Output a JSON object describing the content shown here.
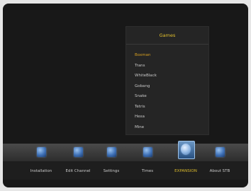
{
  "popup": {
    "title": "Games",
    "items": [
      {
        "label": "Boxman",
        "selected": true
      },
      {
        "label": "Trans",
        "selected": false
      },
      {
        "label": "WhiteBlack",
        "selected": false
      },
      {
        "label": "Gobang",
        "selected": false
      },
      {
        "label": "Snake",
        "selected": false
      },
      {
        "label": "Tetris",
        "selected": false
      },
      {
        "label": "Hexa",
        "selected": false
      },
      {
        "label": "Mine",
        "selected": false
      }
    ]
  },
  "main_menu": {
    "tabs": [
      {
        "label": "Installation",
        "icon": "installation-icon",
        "active": false
      },
      {
        "label": "Edit Channel",
        "icon": "edit-channel-icon",
        "active": false
      },
      {
        "label": "Settings",
        "icon": "settings-icon",
        "active": false
      },
      {
        "label": "Times",
        "icon": "times-icon",
        "active": false
      },
      {
        "label": "EXPANSION",
        "icon": "expansion-icon",
        "active": true
      },
      {
        "label": "About STB",
        "icon": "about-stb-icon",
        "active": false
      }
    ]
  },
  "colors": {
    "background": "#181818",
    "title_text": "#e3c12d",
    "selected_text": "#d8a020",
    "menu_text": "#c9c9c9",
    "active_tab_text": "#d8b82c"
  }
}
